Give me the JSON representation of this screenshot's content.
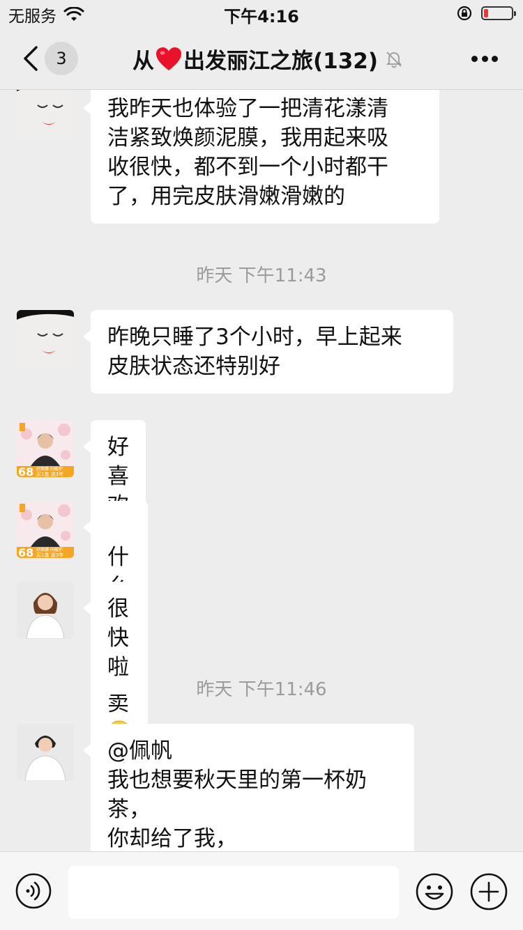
{
  "status_bar": {
    "carrier": "无服务",
    "time": "下午4:16",
    "battery_level": 0.15,
    "battery_color": "#e53935"
  },
  "nav": {
    "back_icon": "chevron-left-icon",
    "unread_count": "3",
    "title_prefix": "从",
    "title_icon": "red-heart-icon",
    "title_suffix": "出发丽江之旅(132)",
    "mute_icon": "bell-muted-icon",
    "more_icon": "more-dots-icon"
  },
  "messages": [
    {
      "type": "message",
      "avatar": "avatar-mask-face",
      "text": "我昨天也体验了一把清花漾清\n洁紧致焕颜泥膜，我用起来吸\n收很快，都不到一个小时都干\n了，用完皮肤滑嫩滑嫩的"
    },
    {
      "type": "timestamp",
      "text": "昨天 下午11:43"
    },
    {
      "type": "message",
      "avatar": "avatar-mask-face",
      "text": "昨晚只睡了3个小时，早上起来\n皮肤状态还特别好"
    },
    {
      "type": "message",
      "avatar": "avatar-promo-68",
      "text": "好喜欢这款面膜"
    },
    {
      "type": "message",
      "avatar": "avatar-promo-68",
      "text": "什么时候有卖",
      "emoji": "grinning-face-emoji"
    },
    {
      "type": "message",
      "avatar": "avatar-woman-white",
      "text": "很快啦"
    },
    {
      "type": "timestamp",
      "text": "昨天 下午11:46"
    },
    {
      "type": "message",
      "avatar": "avatar-woman-white",
      "text": "@佩帆\n我也想要秋天里的第一杯奶\n茶，\n你却给了我，"
    }
  ],
  "promo_avatar": {
    "price": "68",
    "caption_top": "好面膜 向暖护",
    "caption_bottom": "买1盒 送3年"
  },
  "input_bar": {
    "voice_icon": "voice-icon",
    "text_value": "",
    "emoji_icon": "smile-icon",
    "more_icon": "plus-icon"
  }
}
